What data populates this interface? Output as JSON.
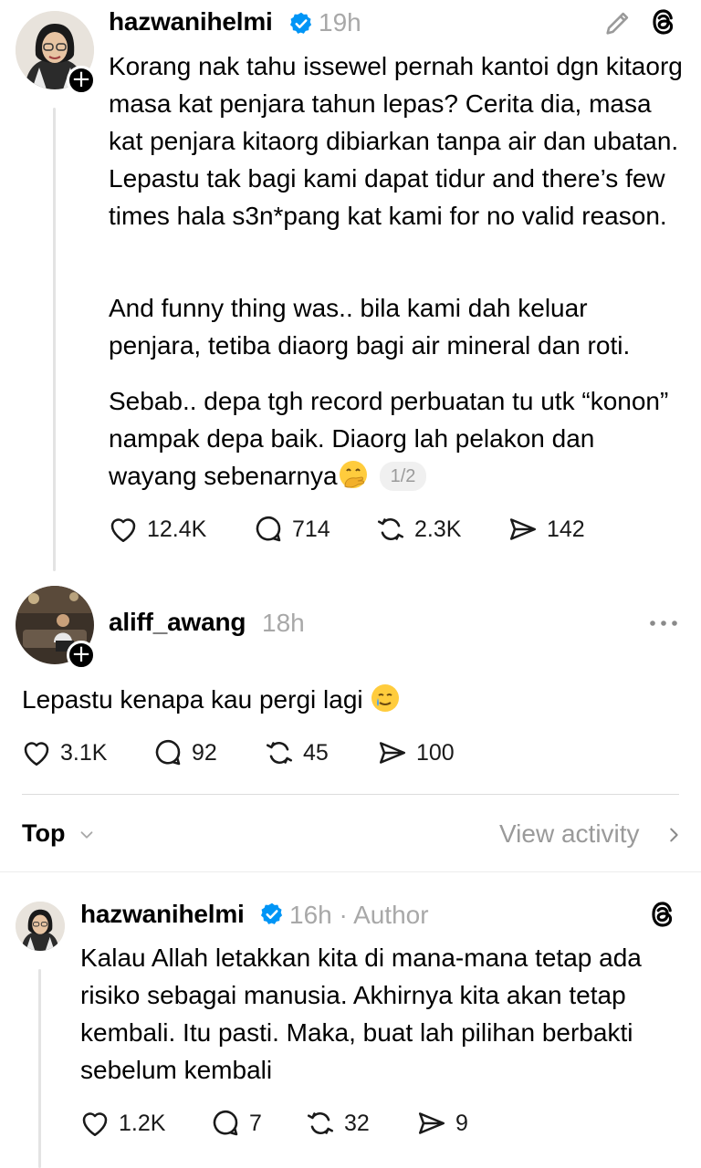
{
  "post1": {
    "username": "hazwanihelmi",
    "time": "19h",
    "paragraphs": [
      "Korang nak tahu issewel pernah kantoi dgn kitaorg masa kat penjara tahun lepas? Cerita dia, masa kat penjara kitaorg dibiarkan tanpa air dan ubatan. Lepastu tak bagi kami dapat tidur and there’s few times hala s3n*pang kat kami for no valid reason.",
      "And funny thing was.. bila kami dah keluar penjara, tetiba diaorg bagi air mineral dan roti.",
      "Sebab.. depa tgh record perbuatan tu utk “konon” nampak depa baik. Diaorg lah pelakon dan wayang sebenarnya"
    ],
    "pager": "1/2",
    "likes": "12.4K",
    "replies": "714",
    "reposts": "2.3K",
    "shares": "142"
  },
  "post2": {
    "username": "aliff_awang",
    "time": "18h",
    "text": "Lepastu kenapa kau pergi lagi",
    "likes": "3.1K",
    "replies": "92",
    "reposts": "45",
    "shares": "100"
  },
  "sort_bar": {
    "label": "Top",
    "view_activity": "View activity"
  },
  "post3": {
    "username": "hazwanihelmi",
    "time": "16h",
    "separator": "·",
    "author_tag": "Author",
    "text": "Kalau Allah letakkan kita di mana-mana tetap ada risiko sebagai manusia. Akhirnya kita akan tetap kembali. Itu pasti. Maka, buat lah pilihan berbakti sebelum kembali",
    "likes": "1.2K",
    "replies": "7",
    "reposts": "32",
    "shares": "9"
  },
  "colors": {
    "verified": "#0095f6",
    "muted": "#a8a8a8",
    "thread_line": "#e3e3e3"
  },
  "icons": [
    "pencil-icon",
    "threads-icon",
    "verified-badge-icon",
    "heart-icon",
    "comment-icon",
    "repost-icon",
    "share-icon",
    "more-icon",
    "chevron-down-icon",
    "chevron-right-icon",
    "plus-icon",
    "emoji-hand-over-mouth",
    "emoji-crying-smile"
  ]
}
